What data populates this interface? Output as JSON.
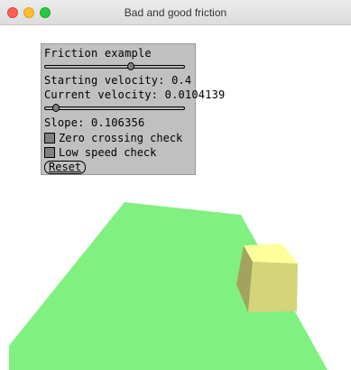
{
  "window": {
    "title": "Bad and good friction"
  },
  "panel": {
    "heading": "Friction example",
    "starting_velocity_slider": {
      "level": 0.62
    },
    "starting_velocity_label": "Starting velocity: 0.4",
    "current_velocity_label": "Current velocity: 0.0104139",
    "slope_slider": {
      "level": 0.06
    },
    "slope_label": "Slope: 0.106356",
    "zero_crossing_check": {
      "label": "Zero crossing check",
      "checked": false
    },
    "low_speed_check": {
      "label": "Low speed check",
      "checked": false
    },
    "reset_label": "Reset"
  },
  "scene": {
    "plane_color": "#80f080",
    "cube_top_color": "#ffff99",
    "cube_front_color": "#d4d47a",
    "cube_side_color": "#a3a35e"
  }
}
